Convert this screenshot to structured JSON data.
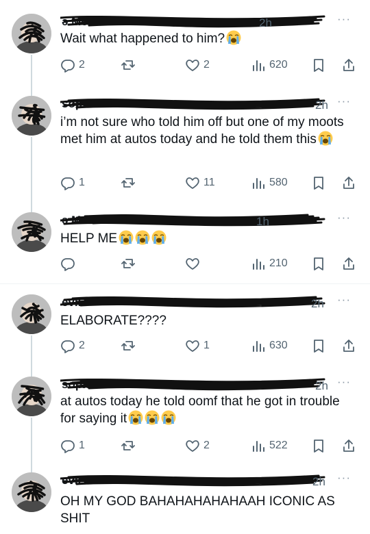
{
  "app": {
    "more_glyph": "···",
    "colors": {
      "text": "#0f1419",
      "muted": "#536471",
      "line": "#cfd9de"
    }
  },
  "tweets": [
    {
      "name": "ə Melo",
      "time": "2h",
      "text": "Wait what happened to him?",
      "emojis": 1,
      "replies": "2",
      "retweets": "",
      "likes": "2",
      "views": "620"
    },
    {
      "name": "soph",
      "time": "2h",
      "text": "i’m not sure who told him off but one of my moots met him at autos today and he told them this",
      "emojis": 1,
      "replies": "1",
      "retweets": "",
      "likes": "11",
      "views": "580"
    },
    {
      "name": "ə Melo",
      "time": "1h",
      "text": "HELP ME",
      "emojis": 3,
      "replies": "",
      "retweets": "",
      "likes": "",
      "views": "210"
    },
    {
      "name": "evil",
      "time": "2h",
      "text": "ELABORATE????",
      "emojis": 0,
      "replies": "2",
      "retweets": "",
      "likes": "1",
      "views": "630"
    },
    {
      "name": "soph",
      "time": "2h",
      "text": "at autos today he told oomf that he got in trouble for saying it",
      "emojis": 3,
      "replies": "1",
      "retweets": "",
      "likes": "2",
      "views": "522"
    },
    {
      "name": "evil",
      "time": "2h",
      "text": "OH MY GOD BAHAHAHAHAHAAH ICONIC AS SHIT",
      "emojis": 0,
      "replies": "",
      "retweets": "",
      "likes": "",
      "views": ""
    }
  ],
  "icons": {
    "reply": "reply-icon",
    "retweet": "retweet-icon",
    "like": "heart-icon",
    "views": "views-icon",
    "bookmark": "bookmark-icon",
    "share": "share-icon"
  }
}
